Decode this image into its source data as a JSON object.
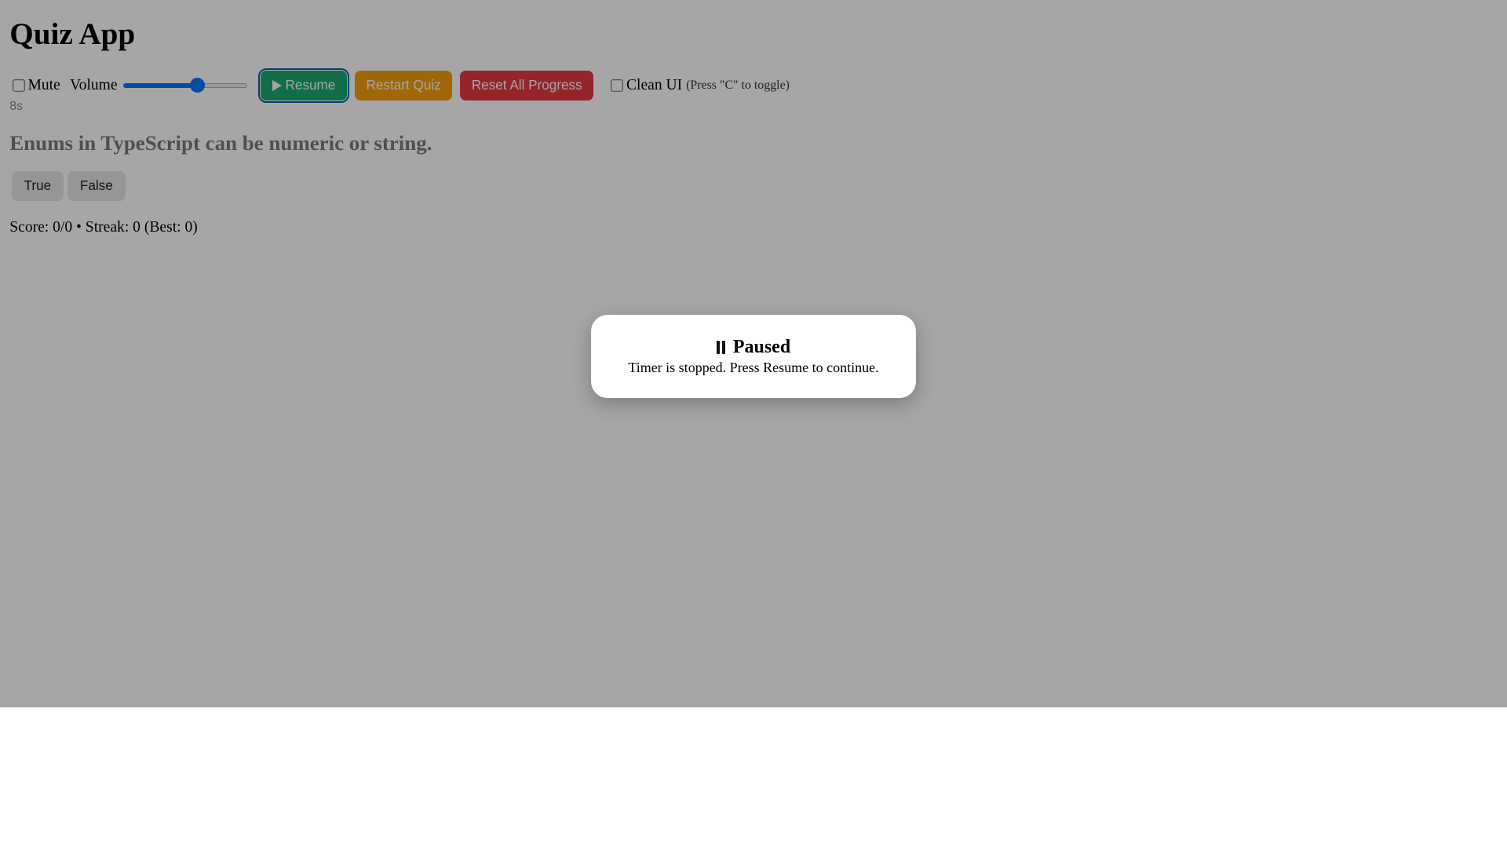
{
  "app": {
    "title": "Quiz App"
  },
  "controls": {
    "mute_label": "Mute",
    "mute_checked": false,
    "volume_label": "Volume",
    "volume_value": 0.6,
    "resume_label": "Resume",
    "restart_label": "Restart Quiz",
    "reset_label": "Reset All Progress",
    "clean_ui_label": "Clean UI",
    "clean_ui_checked": false,
    "clean_ui_hint": "(Press \"C\" to toggle)"
  },
  "timer": {
    "text": "8s"
  },
  "question": {
    "text": "Enums in TypeScript can be numeric or string.",
    "answers": [
      "True",
      "False"
    ]
  },
  "status": {
    "score_text": "Score: 0/0 • Streak: 0 (Best: 0)"
  },
  "modal": {
    "title": "Paused",
    "text": "Timer is stopped. Press Resume to continue."
  },
  "colors": {
    "resume": "#19a974",
    "restart": "#f59e0b",
    "reset": "#e53940",
    "slider_accent": "#0075ff"
  },
  "icons": {
    "resume": "play-icon",
    "modal": "pause-icon"
  }
}
